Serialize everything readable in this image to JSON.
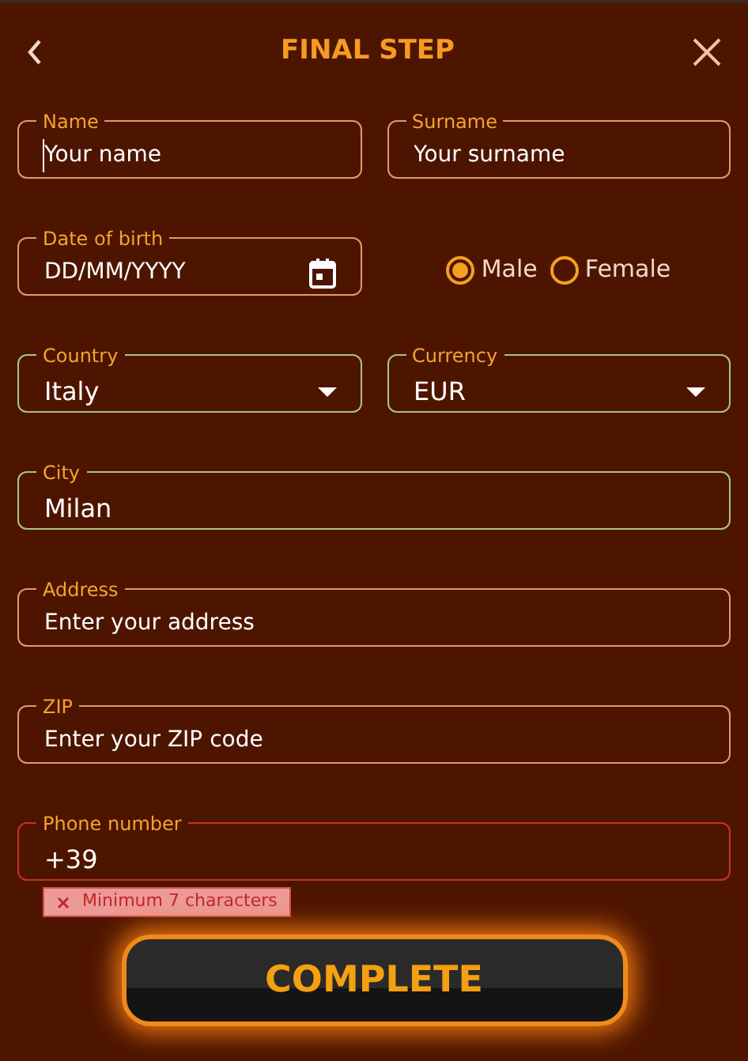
{
  "header": {
    "title": "FINAL STEP"
  },
  "rows": [
    {
      "fields": [
        {
          "kind": "text",
          "label": "Name",
          "placeholder": "Your name",
          "valid": false,
          "focused": true
        },
        {
          "kind": "text",
          "label": "Surname",
          "placeholder": "Your surname",
          "valid": false,
          "focused": false
        }
      ]
    },
    {
      "fields": [
        {
          "kind": "date",
          "label": "Date of birth",
          "placeholder": "DD/MM/YYYY",
          "valid": false,
          "focused": false
        },
        {
          "kind": "radio",
          "options": [
            {
              "label": "Male",
              "selected": true
            },
            {
              "label": "Female",
              "selected": false
            }
          ]
        }
      ]
    },
    {
      "fields": [
        {
          "kind": "select",
          "label": "Country",
          "value": "Italy",
          "valid": true,
          "focused": false
        },
        {
          "kind": "select",
          "label": "Currency",
          "value": "EUR",
          "valid": true,
          "focused": false
        }
      ]
    },
    {
      "fields": [
        {
          "kind": "text",
          "label": "City",
          "value": "Milan",
          "valid": true,
          "focused": false
        }
      ]
    },
    {
      "fields": [
        {
          "kind": "text",
          "label": "Address",
          "placeholder": "Enter your address",
          "valid": false,
          "focused": false
        }
      ]
    },
    {
      "fields": [
        {
          "kind": "text",
          "label": "ZIP",
          "placeholder": "Enter your ZIP code",
          "valid": false,
          "focused": false
        }
      ]
    },
    {
      "fields": [
        {
          "kind": "text",
          "label": "Phone number",
          "value": "+39",
          "valid": false,
          "focused": false,
          "error": "Minimum 7 characters"
        }
      ]
    }
  ],
  "submit": {
    "label": "COMPLETE"
  }
}
